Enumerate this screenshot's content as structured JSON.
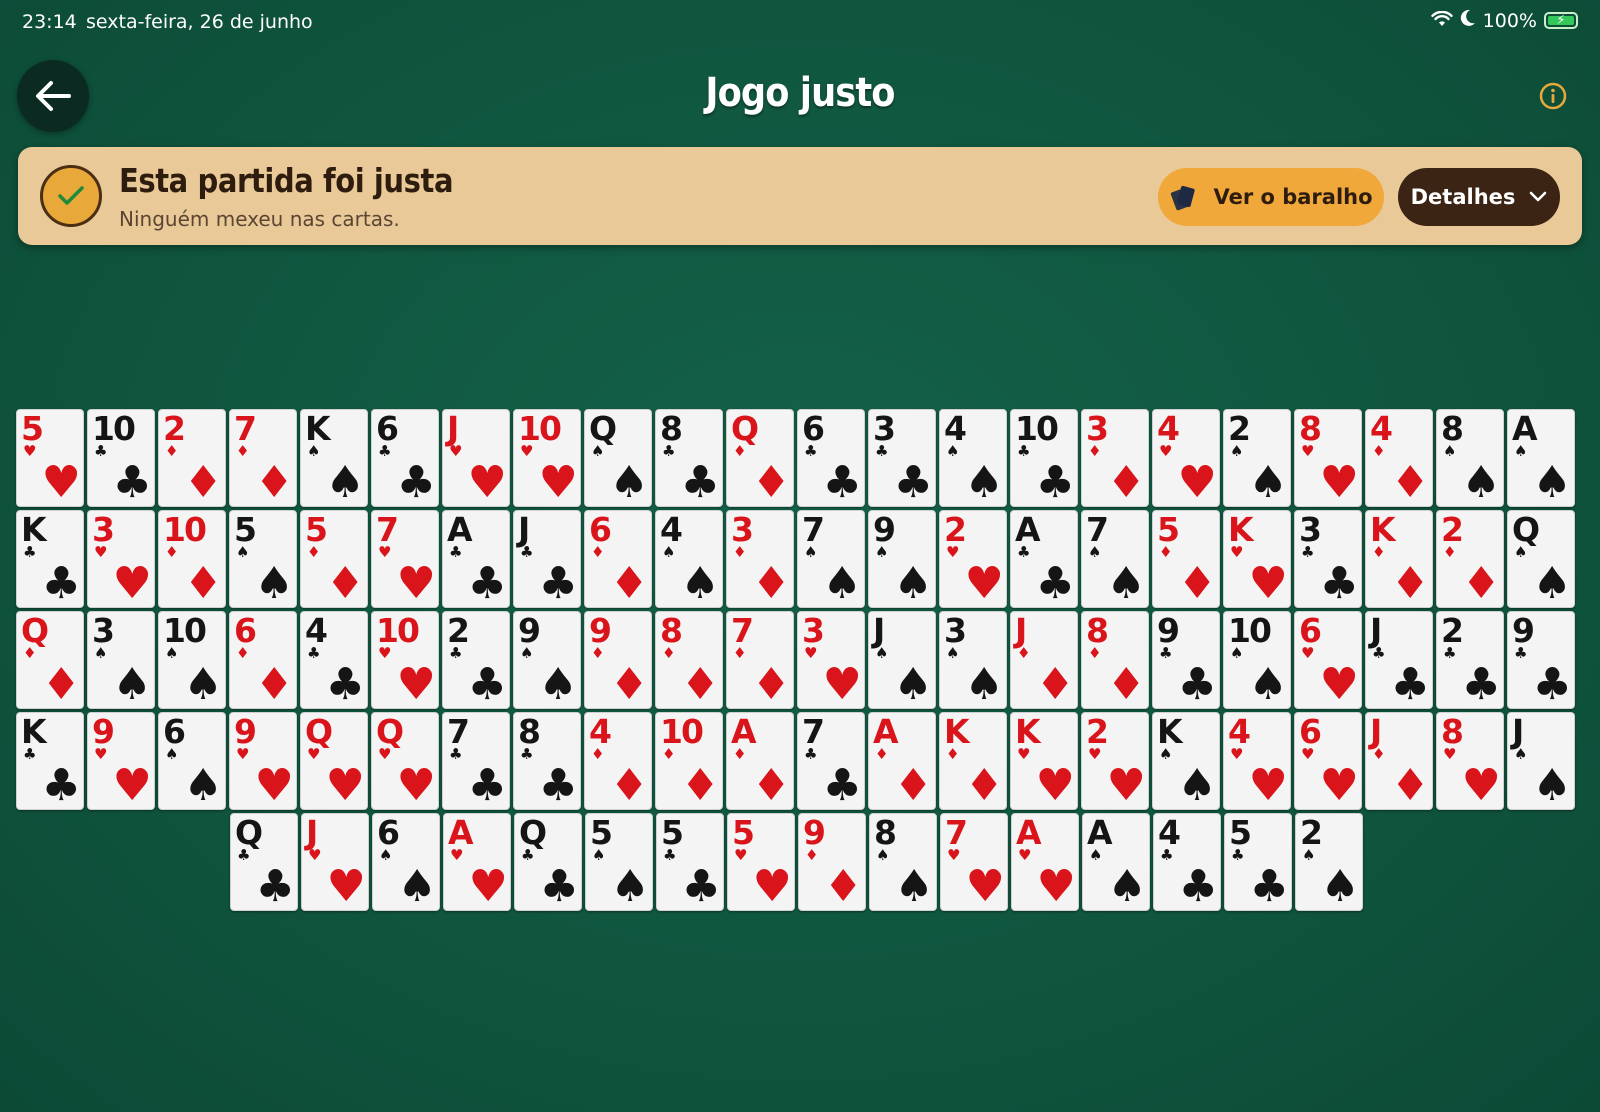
{
  "status_bar": {
    "time": "23:14",
    "date": "sexta-feira, 26 de junho",
    "battery": "100%"
  },
  "header": {
    "title": "Jogo justo",
    "back_icon": "arrow-left-icon",
    "info_icon": "info-icon"
  },
  "banner": {
    "title": "Esta partida foi justa",
    "subtitle": "Ninguém mexeu nas cartas.",
    "deck_button": "Ver o baralho",
    "details_button": "Detalhes",
    "colors": {
      "banner_bg": "#e9c998",
      "deck_button_bg": "#f0a83a",
      "details_button_bg": "#3b2414",
      "check_bg": "#e9a83a"
    }
  },
  "cards": [
    [
      [
        "5",
        "H"
      ],
      [
        "10",
        "C"
      ],
      [
        "2",
        "D"
      ],
      [
        "7",
        "D"
      ],
      [
        "K",
        "S"
      ],
      [
        "6",
        "C"
      ],
      [
        "J",
        "H"
      ],
      [
        "10",
        "H"
      ],
      [
        "Q",
        "S"
      ],
      [
        "8",
        "C"
      ],
      [
        "Q",
        "D"
      ],
      [
        "6",
        "C"
      ],
      [
        "3",
        "C"
      ],
      [
        "4",
        "S"
      ],
      [
        "10",
        "C"
      ],
      [
        "3",
        "D"
      ],
      [
        "4",
        "H"
      ],
      [
        "2",
        "S"
      ],
      [
        "8",
        "H"
      ],
      [
        "4",
        "D"
      ],
      [
        "8",
        "S"
      ],
      [
        "A",
        "S"
      ]
    ],
    [
      [
        "K",
        "C"
      ],
      [
        "3",
        "H"
      ],
      [
        "10",
        "D"
      ],
      [
        "5",
        "S"
      ],
      [
        "5",
        "D"
      ],
      [
        "7",
        "H"
      ],
      [
        "A",
        "C"
      ],
      [
        "J",
        "C"
      ],
      [
        "6",
        "D"
      ],
      [
        "4",
        "S"
      ],
      [
        "3",
        "D"
      ],
      [
        "7",
        "S"
      ],
      [
        "9",
        "S"
      ],
      [
        "2",
        "H"
      ],
      [
        "A",
        "C"
      ],
      [
        "7",
        "S"
      ],
      [
        "5",
        "D"
      ],
      [
        "K",
        "H"
      ],
      [
        "3",
        "C"
      ],
      [
        "K",
        "D"
      ],
      [
        "2",
        "D"
      ],
      [
        "Q",
        "S"
      ]
    ],
    [
      [
        "Q",
        "D"
      ],
      [
        "3",
        "S"
      ],
      [
        "10",
        "S"
      ],
      [
        "6",
        "D"
      ],
      [
        "4",
        "C"
      ],
      [
        "10",
        "H"
      ],
      [
        "2",
        "C"
      ],
      [
        "9",
        "S"
      ],
      [
        "9",
        "D"
      ],
      [
        "8",
        "D"
      ],
      [
        "7",
        "D"
      ],
      [
        "3",
        "H"
      ],
      [
        "J",
        "S"
      ],
      [
        "3",
        "S"
      ],
      [
        "J",
        "D"
      ],
      [
        "8",
        "D"
      ],
      [
        "9",
        "C"
      ],
      [
        "10",
        "S"
      ],
      [
        "6",
        "H"
      ],
      [
        "J",
        "C"
      ],
      [
        "2",
        "C"
      ],
      [
        "9",
        "C"
      ]
    ],
    [
      [
        "K",
        "C"
      ],
      [
        "9",
        "H"
      ],
      [
        "6",
        "S"
      ],
      [
        "9",
        "H"
      ],
      [
        "Q",
        "H"
      ],
      [
        "Q",
        "H"
      ],
      [
        "7",
        "C"
      ],
      [
        "8",
        "C"
      ],
      [
        "4",
        "D"
      ],
      [
        "10",
        "D"
      ],
      [
        "A",
        "D"
      ],
      [
        "7",
        "C"
      ],
      [
        "A",
        "D"
      ],
      [
        "K",
        "D"
      ],
      [
        "K",
        "H"
      ],
      [
        "2",
        "H"
      ],
      [
        "K",
        "S"
      ],
      [
        "4",
        "H"
      ],
      [
        "6",
        "H"
      ],
      [
        "J",
        "D"
      ],
      [
        "8",
        "H"
      ],
      [
        "J",
        "S"
      ]
    ],
    [
      [
        "Q",
        "C"
      ],
      [
        "J",
        "H"
      ],
      [
        "6",
        "S"
      ],
      [
        "A",
        "H"
      ],
      [
        "Q",
        "C"
      ],
      [
        "5",
        "S"
      ],
      [
        "5",
        "C"
      ],
      [
        "5",
        "H"
      ],
      [
        "9",
        "D"
      ],
      [
        "8",
        "S"
      ],
      [
        "7",
        "H"
      ],
      [
        "A",
        "H"
      ],
      [
        "A",
        "S"
      ],
      [
        "4",
        "C"
      ],
      [
        "5",
        "C"
      ],
      [
        "2",
        "S"
      ]
    ]
  ]
}
